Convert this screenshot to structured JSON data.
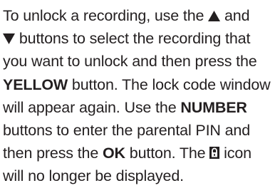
{
  "paragraph": {
    "l1_a": "To unlock a recording, use the ",
    "l1_b": " and",
    "l2_a": " buttons to select the recording that",
    "l3_a": "you want to unlock and then press the",
    "l4_a": "YELLOW",
    "l4_b": " button. The lock code window",
    "l5_a": "will appear again. Use the ",
    "l5_b": "NUMBER",
    "l6_a": "buttons to enter the parental PIN and",
    "l7_a": "then press the ",
    "l7_b": "OK",
    "l7_c": " button. The ",
    "l7_d": " icon",
    "l8_a": "will no longer be displayed."
  },
  "icons": {
    "up": "up-arrow-icon",
    "down": "down-arrow-icon",
    "lock": "padlock-icon"
  },
  "colors": {
    "text": "#231f20"
  }
}
